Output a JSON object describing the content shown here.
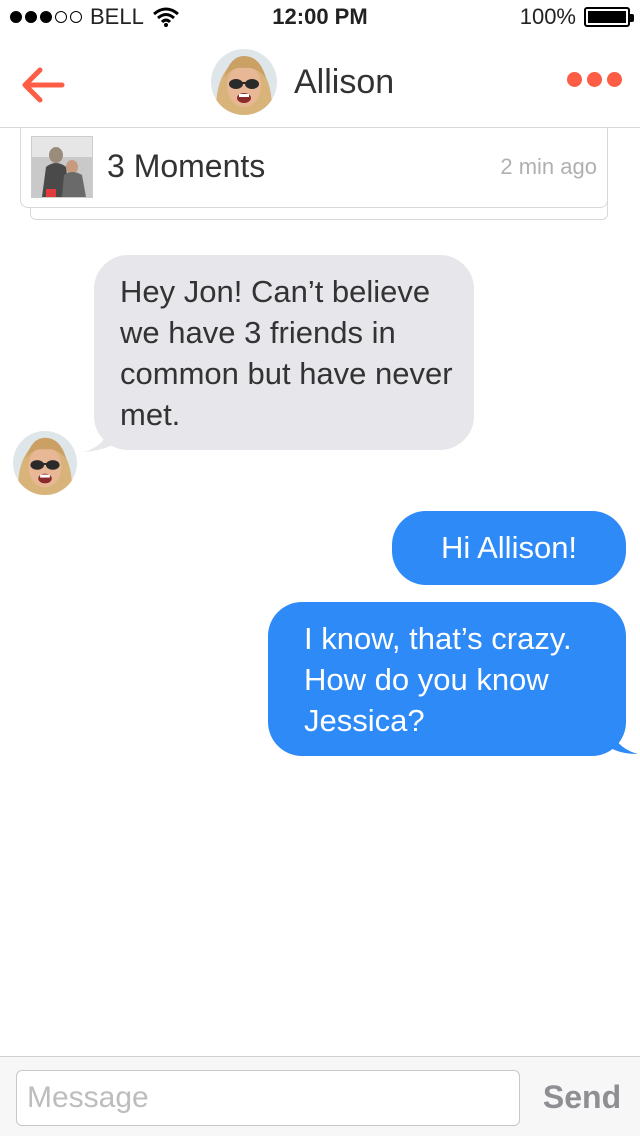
{
  "status_bar": {
    "carrier": "BELL",
    "time": "12:00 PM",
    "battery": "100%",
    "signal_bars_filled": 3,
    "signal_bars_total": 5
  },
  "nav": {
    "contact_name": "Allison",
    "back_icon": "arrow-left-icon",
    "more_icon": "more-dots-icon",
    "accent_color": "#fd5c45"
  },
  "moments": {
    "title": "3 Moments",
    "time": "2 min ago"
  },
  "messages": [
    {
      "direction": "incoming",
      "text": "Hey Jon! Can’t believe we have 3 friends in common but have never met."
    },
    {
      "direction": "outgoing",
      "text": "Hi Allison!"
    },
    {
      "direction": "outgoing",
      "text": "I know, that’s crazy. How do you know Jessica?"
    }
  ],
  "composer": {
    "placeholder": "Message",
    "value": "",
    "send_label": "Send"
  },
  "colors": {
    "outgoing_bubble": "#2e8af7",
    "incoming_bubble": "#e6e6eb"
  }
}
